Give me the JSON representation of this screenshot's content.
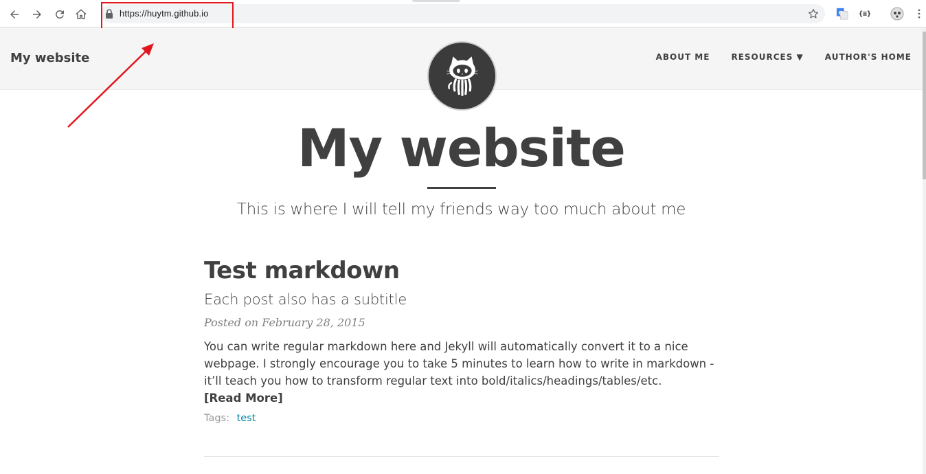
{
  "browser": {
    "url": "https://huytm.github.io",
    "icons": {
      "back": "arrow-left-icon",
      "forward": "arrow-right-icon",
      "reload": "reload-icon",
      "home": "home-icon",
      "lock": "lock-icon",
      "bookmark": "star-icon",
      "translate": "google-translate-icon",
      "json": "json-extension-icon",
      "profile": "profile-icon",
      "menu": "kebab-menu-icon"
    },
    "json_ext_label": "{≡}"
  },
  "nav": {
    "brand": "My website",
    "links": [
      {
        "label": "ABOUT ME"
      },
      {
        "label": "RESOURCES ▼"
      },
      {
        "label": "AUTHOR'S HOME"
      }
    ],
    "avatar": "github-octocat-icon"
  },
  "header": {
    "title": "My website",
    "subtitle": "This is where I will tell my friends way too much about me"
  },
  "post": {
    "title": "Test markdown",
    "subtitle": "Each post also has a subtitle",
    "meta": "Posted on February 28, 2015",
    "excerpt": "You can write regular markdown here and Jekyll will automatically convert it to a nice webpage. I strongly encourage you to take 5 minutes to learn how to write in markdown - it’ll teach you how to transform regular text into bold/italics/headings/tables/etc.",
    "read_more": "[Read More]",
    "tags_label": "Tags:",
    "tags": [
      "test"
    ]
  },
  "colors": {
    "annotation": "#e0161f",
    "text": "#404040",
    "nav_bg": "#f5f5f5",
    "link": "#0085a1"
  }
}
